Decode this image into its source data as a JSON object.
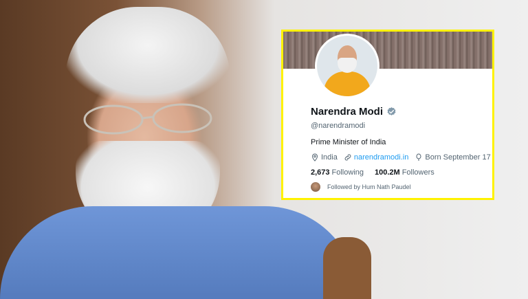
{
  "profile": {
    "name": "Narendra Modi",
    "handle": "@narendramodi",
    "bio": "Prime Minister of India",
    "location": "India",
    "website": "narendramodi.in",
    "birthday": "Born September 17",
    "following_count": "2,673",
    "following_label": "Following",
    "followers_count": "100.2M",
    "followers_label": "Followers",
    "followed_by": "Followed by Hum Nath Paudel",
    "verified": true
  },
  "colors": {
    "card_border": "#fff200",
    "link": "#1d9bf0",
    "verified_badge": "#829aab",
    "secondary_text": "#536471"
  },
  "icons": {
    "location": "location-pin-icon",
    "link": "link-icon",
    "birthday": "balloon-icon",
    "verified": "verified-badge-icon"
  }
}
